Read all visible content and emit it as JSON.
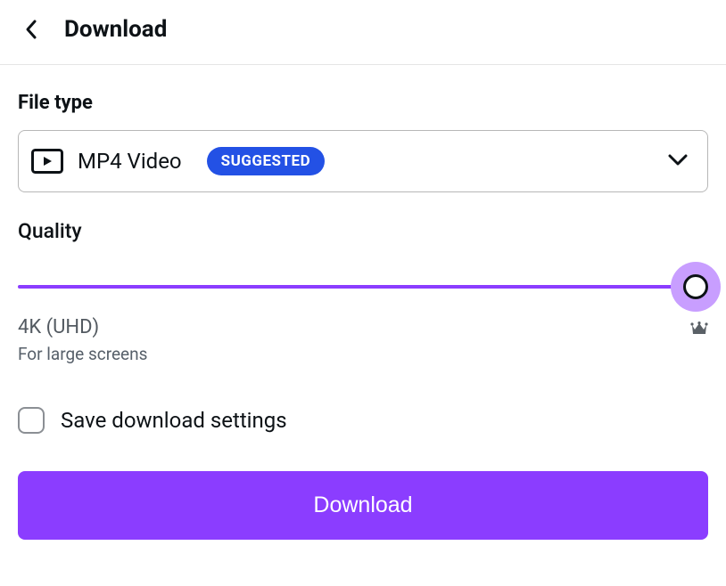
{
  "header": {
    "title": "Download"
  },
  "fileType": {
    "label": "File type",
    "selected": "MP4 Video",
    "badge": "SUGGESTED"
  },
  "quality": {
    "label": "Quality",
    "valueName": "4K (UHD)",
    "description": "For large screens",
    "sliderPercent": 100
  },
  "save": {
    "label": "Save download settings",
    "checked": false
  },
  "actions": {
    "download": "Download"
  },
  "colors": {
    "accent": "#8b3dff",
    "badge": "#2351e5"
  }
}
